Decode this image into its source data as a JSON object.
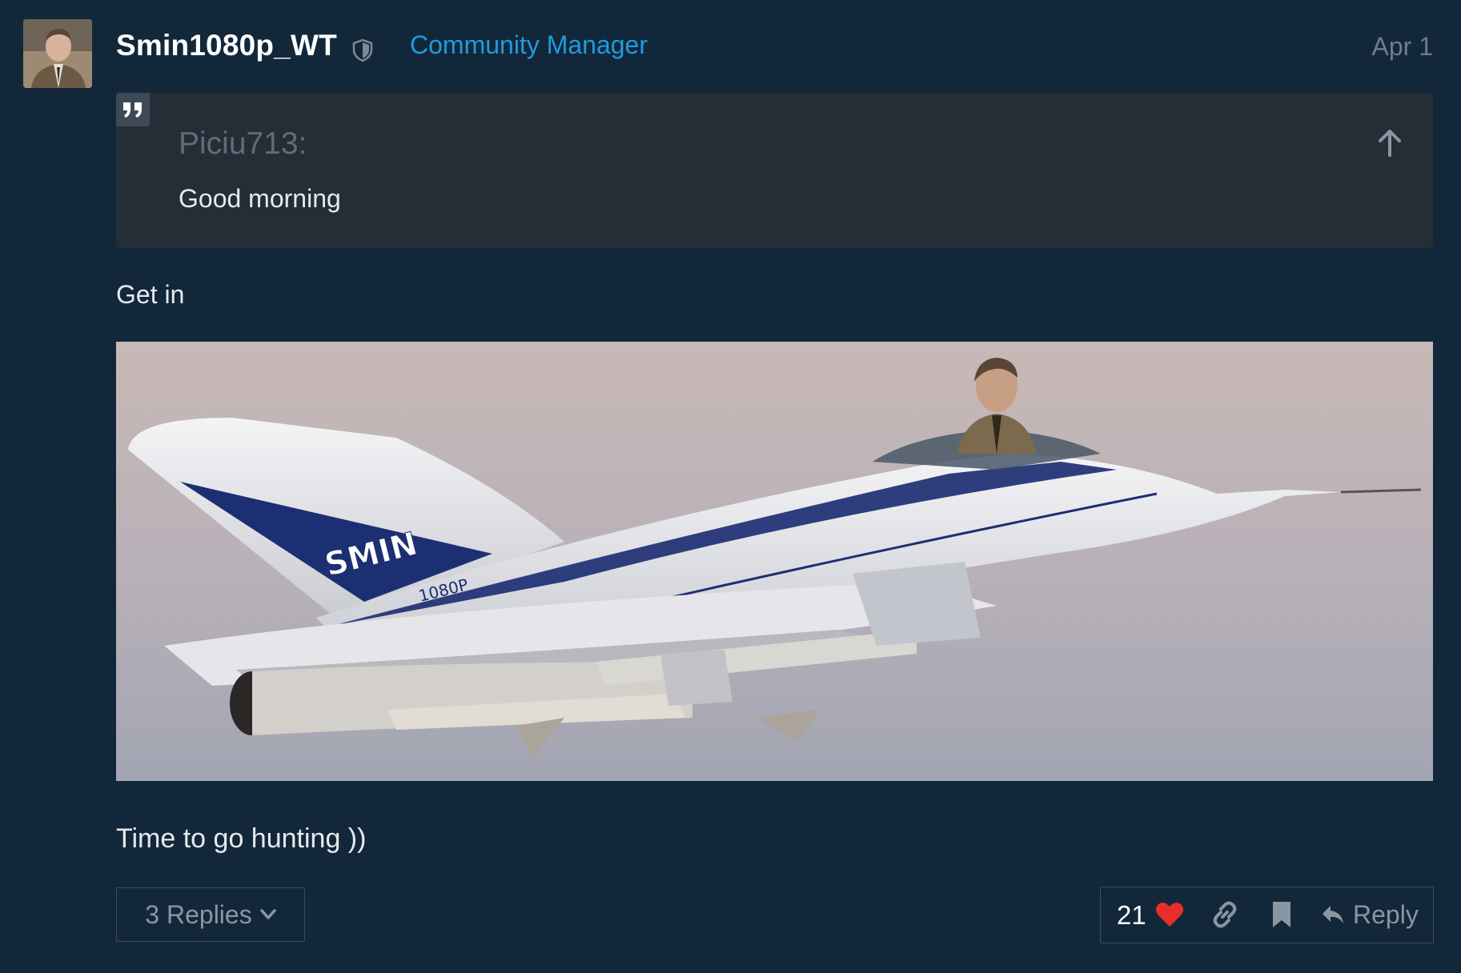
{
  "post": {
    "username": "Smin1080p_WT",
    "user_title": "Community Manager",
    "date": "Apr 1",
    "quote": {
      "author": "Piciu713:",
      "text": "Good morning"
    },
    "paragraph_1": "Get in",
    "image": {
      "logo_text": "SMIN",
      "tail_text": "1080P"
    },
    "paragraph_2": "Time to go hunting ))"
  },
  "footer": {
    "replies_label": "3 Replies",
    "like_count": "21",
    "reply_label": "Reply"
  },
  "colors": {
    "background": "#12283a",
    "accent": "#1f9bde",
    "heart": "#e82d2d"
  }
}
